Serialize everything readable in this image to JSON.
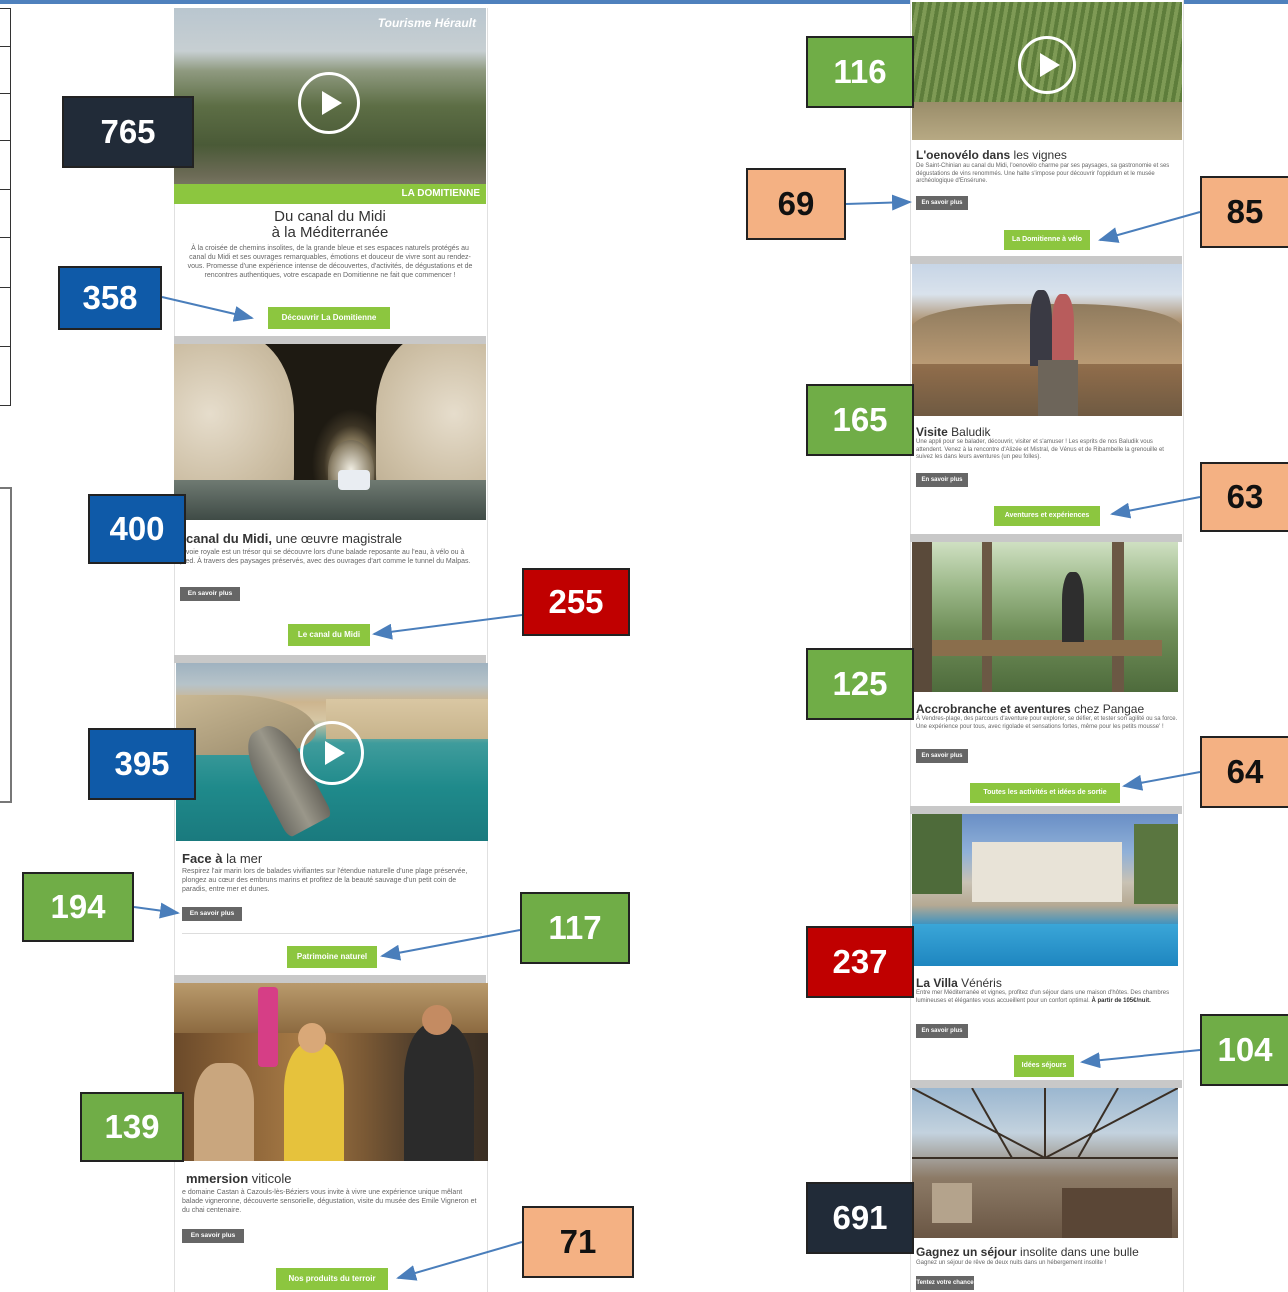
{
  "left_email": {
    "hero": {
      "brand": "Tourisme Hérault",
      "banner": "LA DOMITIENNE",
      "title_line1": "Du canal du Midi",
      "title_line2": "à la Méditerranée",
      "intro": "À la croisée de chemins insolites, de la grande bleue et ses espaces naturels protégés au canal du Midi et ses ouvrages remarquables, émotions et douceur de vivre sont au rendez-vous. Promesse d'une expérience intense de découvertes, d'activités, de dégustations et de rencontres authentiques, votre escapade en Domitienne ne fait que commencer !",
      "cta": "Découvrir La Domitienne"
    },
    "canal": {
      "title_bold": "canal du Midi,",
      "title_rest": " une œuvre magistrale",
      "desc": "e voie royale est un trésor qui se découvre lors d'une balade reposante au l'eau, à vélo ou à pied. À travers des paysages préservés, avec des ouvrages d'art comme le tunnel du Malpas.",
      "more": "En savoir plus",
      "cta": "Le canal du Midi"
    },
    "mer": {
      "title_bold": "Face à",
      "title_rest": " la mer",
      "desc": "Respirez l'air marin lors de balades vivifiantes sur l'étendue naturelle d'une plage préservée, plongez au cœur des embruns marins et profitez de la beauté sauvage d'un petit coin de paradis, entre mer et dunes.",
      "more": "En savoir plus",
      "cta": "Patrimoine naturel"
    },
    "viticole": {
      "title_bold": "mmersion",
      "title_rest": " viticole",
      "desc": "e domaine Castan à Cazouls-lès-Béziers vous invite à vivre une expérience unique mêlant balade vigneronne, découverte sensorielle, dégustation, visite du musée des Emile Vigneron et du chai centenaire.",
      "more": "En savoir plus",
      "cta": "Nos produits du terroir"
    }
  },
  "right_email": {
    "oenovelo": {
      "title_bold": "L'oenovélo dans",
      "title_rest": " les vignes",
      "desc": "De Saint-Chinian au canal du Midi, l'oenovélo charme par ses paysages, sa gastronomie et ses dégustations de vins renommés. Une halte s'impose pour découvrir l'oppidum et le musée archéologique d'Ensérune.",
      "more": "En savoir plus",
      "cta": "La Domitienne à vélo"
    },
    "baludik": {
      "title_bold": "Visite",
      "title_rest": " Baludik",
      "desc": "Une appli pour se balader, découvrir, visiter et s'amuser ! Les esprits de nos Baludik vous attendent. Venez à la rencontre d'Alizée et Mistral, de Vénus et de Ribambelle la grenouille et suivez les dans leurs aventures (un peu folles).",
      "more": "En savoir plus",
      "cta": "Aventures et expériences"
    },
    "pangae": {
      "title_bold": "Accrobranche et aventures",
      "title_rest": " chez Pangae",
      "desc": "À Vendres-plage, des parcours d'aventure pour explorer, se défier, et tester son agilité ou sa force. Une expérience pour tous, avec rigolade et sensations fortes, même pour les petits mousse' !",
      "more": "En savoir plus",
      "cta": "Toutes les activités et idées de sortie"
    },
    "villa": {
      "title_bold": "La Villa",
      "title_rest": " Vénéris",
      "desc": "Entre mer Méditerranée et vignes, profitez d'un séjour dans une maison d'hôtes. Des chambres lumineuses et élégantes vous accueillent pour un confort optimal.",
      "desc_bold": "À partir de 105€/nuit.",
      "more": "En savoir plus",
      "cta": "Idées séjours"
    },
    "bulle": {
      "title_bold": "Gagnez un séjour",
      "title_rest": " insolite dans une bulle",
      "desc": "Gagnez un séjour de rêve de deux nuits dans un hébergement insolite !",
      "more": "Tentez votre chance"
    }
  },
  "badges": {
    "hero_image": "765",
    "hero_cta": "358",
    "canal_image": "400",
    "canal_cta": "255",
    "mer_image": "395",
    "mer_more": "194",
    "mer_cta": "117",
    "viticole_image": "139",
    "viticole_cta": "71",
    "oenovelo_image": "116",
    "oenovelo_more": "69",
    "oenovelo_cta": "85",
    "baludik_image": "165",
    "baludik_cta": "63",
    "pangae_image": "125",
    "pangae_cta": "64",
    "villa_image": "237",
    "villa_cta": "104",
    "bulle_image": "691"
  },
  "colors": {
    "green_button": "#8cc63f",
    "gray_button": "#666666",
    "badge_dark": "#212b38",
    "badge_blue": "#0f5aa8",
    "badge_green": "#70ad47",
    "badge_red": "#c00000",
    "badge_orange": "#f4b183",
    "arrow": "#4a7ebb"
  }
}
